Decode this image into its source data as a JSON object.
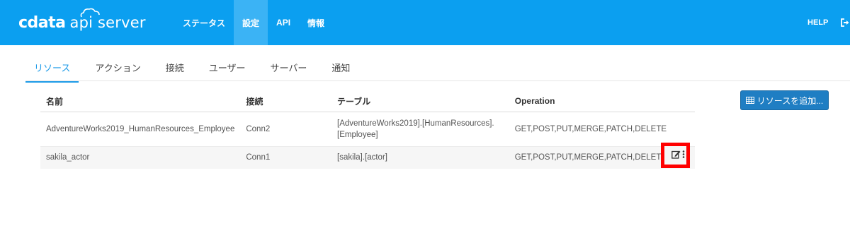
{
  "app": {
    "logo_brand": "cdata",
    "logo_product": "api server"
  },
  "nav": {
    "items": [
      {
        "label": "ステータス"
      },
      {
        "label": "設定"
      },
      {
        "label": "API"
      },
      {
        "label": "情報"
      }
    ],
    "help_label": "HELP"
  },
  "tabs": [
    {
      "label": "リソース"
    },
    {
      "label": "アクション"
    },
    {
      "label": "接続"
    },
    {
      "label": "ユーザー"
    },
    {
      "label": "サーバー"
    },
    {
      "label": "通知"
    }
  ],
  "table": {
    "headers": [
      "名前",
      "接続",
      "テーブル",
      "Operation"
    ],
    "rows": [
      {
        "name": "AdventureWorks2019_HumanResources_Employee",
        "connection": "Conn2",
        "table": "[AdventureWorks2019].[HumanResources].[Employee]",
        "operation": "GET,POST,PUT,MERGE,PATCH,DELETE"
      },
      {
        "name": "sakila_actor",
        "connection": "Conn1",
        "table": "[sakila].[actor]",
        "operation": "GET,POST,PUT,MERGE,PATCH,DELETE"
      }
    ]
  },
  "add_button_label": "リソースを追加...",
  "colors": {
    "topbar": "#0b9ff0",
    "active_nav": "#3bb3f5",
    "active_tab": "#1d9be8",
    "add_button": "#1f7ec3",
    "highlight": "#ff0000"
  },
  "icons": {
    "logo": "cloud-icon",
    "logout": "logout-icon",
    "add": "table-grid-icon",
    "edit": "edit-icon",
    "more": "more-icon"
  }
}
